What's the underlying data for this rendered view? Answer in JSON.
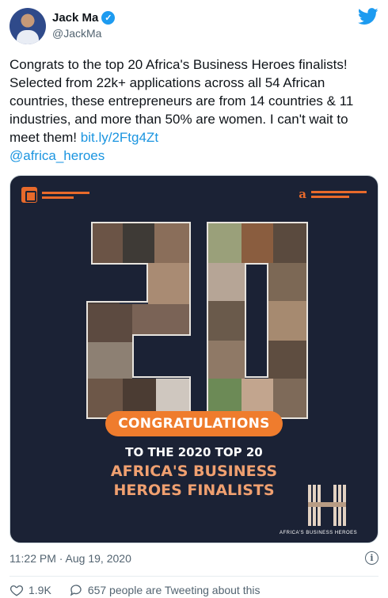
{
  "author": {
    "display_name": "Jack Ma",
    "handle": "@JackMa",
    "verified_icon": "verified-badge-icon"
  },
  "brand": {
    "logo_icon": "twitter-bird-icon",
    "accent": "#1d9bf0"
  },
  "tweet": {
    "text": "Congrats to the top 20 Africa's Business Heroes finalists! Selected from 22k+ applications across all 54 African countries, these entrepreneurs are from 14 countries & 11 industries, and more than 50% are women. I can't wait to meet them!",
    "link": "bit.ly/2Ftg4Zt",
    "mention": "@africa_heroes"
  },
  "media": {
    "big_number": "20",
    "banner": "CONGRATULATIONS",
    "line1": "TO THE 2020 TOP 20",
    "line2": "AFRICA'S BUSINESS",
    "line3": "HEROES FINALISTS",
    "footer": "AFRICA'S BUSINESS HEROES",
    "right_logo": "Alibaba Foundation",
    "colors": {
      "background": "#1b2235",
      "accent": "#ef7c2d"
    }
  },
  "meta": {
    "timestamp": "11:22 PM · Aug 19, 2020",
    "like_count": "1.9K",
    "tweeting_text": "657 people are Tweeting about this"
  }
}
